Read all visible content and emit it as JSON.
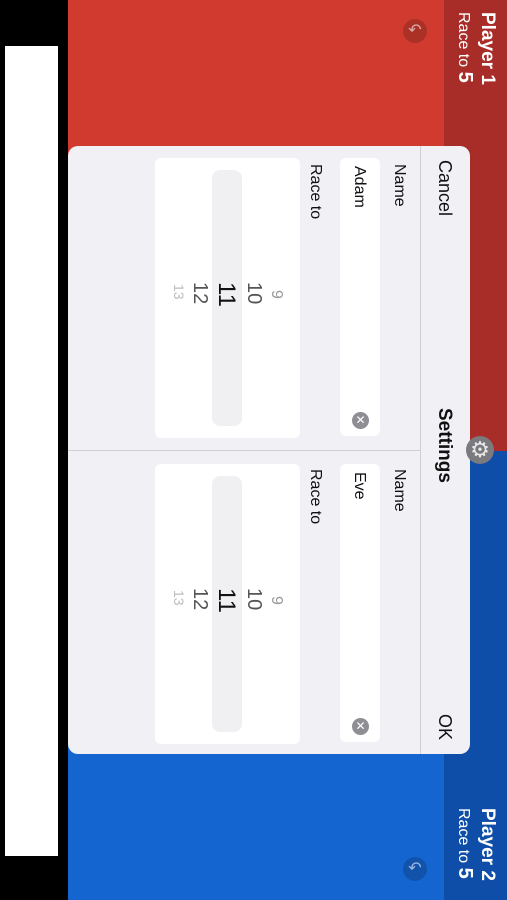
{
  "player1": {
    "name": "Player 1",
    "race_prefix": "Race to",
    "race_value": "5",
    "color": "#d13b2f"
  },
  "player2": {
    "name": "Player 2",
    "race_prefix": "Race to",
    "race_value": "5",
    "color": "#1565d1"
  },
  "dialog": {
    "cancel_label": "Cancel",
    "title": "Settings",
    "ok_label": "OK",
    "p1": {
      "name_label": "Name",
      "name_value": "Adam",
      "race_label": "Race to",
      "picker": [
        "9",
        "10",
        "11",
        "12",
        "13"
      ],
      "selected": "11"
    },
    "p2": {
      "name_label": "Name",
      "name_value": "Eve",
      "race_label": "Race to",
      "picker": [
        "9",
        "10",
        "11",
        "12",
        "13"
      ],
      "selected": "11"
    }
  },
  "icons": {
    "undo": "undo-icon",
    "gear": "gear-icon",
    "clear": "clear-icon"
  }
}
